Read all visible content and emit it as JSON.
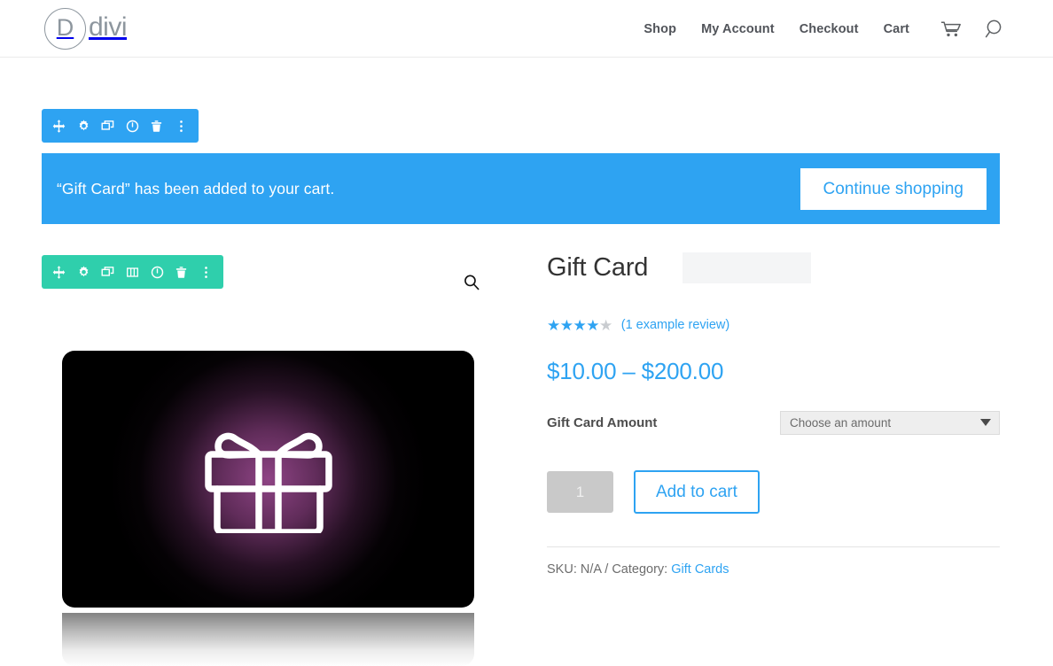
{
  "header": {
    "logo_letter": "D",
    "logo_text": "divi",
    "nav": [
      {
        "label": "Shop"
      },
      {
        "label": "My Account"
      },
      {
        "label": "Checkout"
      },
      {
        "label": "Cart"
      }
    ],
    "cart_icon": "shopping-cart-icon",
    "search_icon": "search-icon"
  },
  "builder": {
    "section_toolbar": {
      "color": "#2ea3f2",
      "buttons": [
        "move-icon",
        "gear-icon",
        "duplicate-icon",
        "power-icon",
        "trash-icon",
        "more-options-icon"
      ]
    },
    "row_toolbar": {
      "color": "#2fcfac",
      "buttons": [
        "move-icon",
        "gear-icon",
        "duplicate-icon",
        "columns-icon",
        "power-icon",
        "trash-icon",
        "more-options-icon"
      ]
    }
  },
  "notice": {
    "message": "“Gift Card” has been added to your cart.",
    "button_label": "Continue shopping",
    "background": "#2ea3f2"
  },
  "gallery": {
    "zoom_icon": "magnifier-icon",
    "image_alt": "Gift card with glowing gift box",
    "image_icon": "gift-box-icon"
  },
  "product": {
    "title": "Gift Card",
    "rating": {
      "filled": 4,
      "total": 5,
      "review_text": "(1 example review)"
    },
    "price": "$10.00 – $200.00",
    "price_color": "#2ea3f2",
    "variation": {
      "label": "Gift Card Amount",
      "selected": "Choose an amount",
      "options": [
        "Choose an amount"
      ]
    },
    "quantity": "1",
    "add_to_cart_label": "Add to cart",
    "meta": {
      "prefix": "SKU: N/A / Category: ",
      "category_link": "Gift Cards"
    }
  }
}
